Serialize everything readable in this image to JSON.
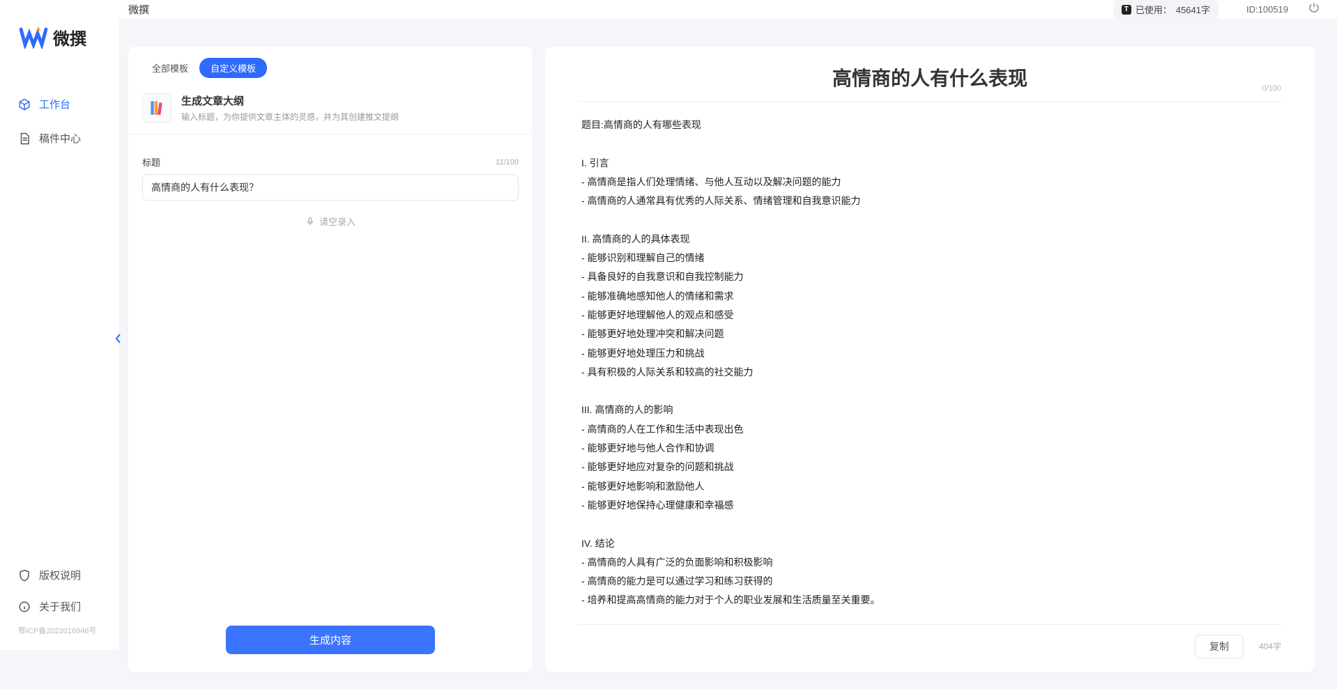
{
  "app": {
    "name": "微撰"
  },
  "sidebar": {
    "items": [
      {
        "label": "工作台"
      },
      {
        "label": "稿件中心"
      }
    ],
    "bottom": [
      {
        "label": "版权说明"
      },
      {
        "label": "关于我们"
      }
    ],
    "icp": "鄂ICP备2022016946号"
  },
  "topbar": {
    "title": "微撰",
    "usage_prefix": "已使用：",
    "usage_value": "45641字",
    "user_id": "ID:100519"
  },
  "tabs": {
    "all": "全部模板",
    "custom": "自定义模板"
  },
  "template": {
    "title": "生成文章大纲",
    "desc": "输入标题，为你提供文章主体的灵感，并为其创建推文提纲"
  },
  "form": {
    "label": "标题",
    "counter": "11/100",
    "input_value": "高情商的人有什么表现？",
    "voice_hint": "请空录入",
    "generate": "生成内容"
  },
  "output": {
    "title": "高情商的人有什么表现",
    "header_counter": "0/100",
    "body": "题目:高情商的人有哪些表现\n\nI. 引言\n- 高情商是指人们处理情绪、与他人互动以及解决问题的能力\n- 高情商的人通常具有优秀的人际关系、情绪管理和自我意识能力\n\nII. 高情商的人的具体表现\n- 能够识别和理解自己的情绪\n- 具备良好的自我意识和自我控制能力\n- 能够准确地感知他人的情绪和需求\n- 能够更好地理解他人的观点和感受\n- 能够更好地处理冲突和解决问题\n- 能够更好地处理压力和挑战\n- 具有积极的人际关系和较高的社交能力\n\nIII. 高情商的人的影响\n- 高情商的人在工作和生活中表现出色\n- 能够更好地与他人合作和协调\n- 能够更好地应对复杂的问题和挑战\n- 能够更好地影响和激励他人\n- 能够更好地保持心理健康和幸福感\n\nIV. 结论\n- 高情商的人具有广泛的负面影响和积极影响\n- 高情商的能力是可以通过学习和练习获得的\n- 培养和提高高情商的能力对于个人的职业发展和生活质量至关重要。",
    "copy": "复制",
    "word_count": "404字"
  }
}
